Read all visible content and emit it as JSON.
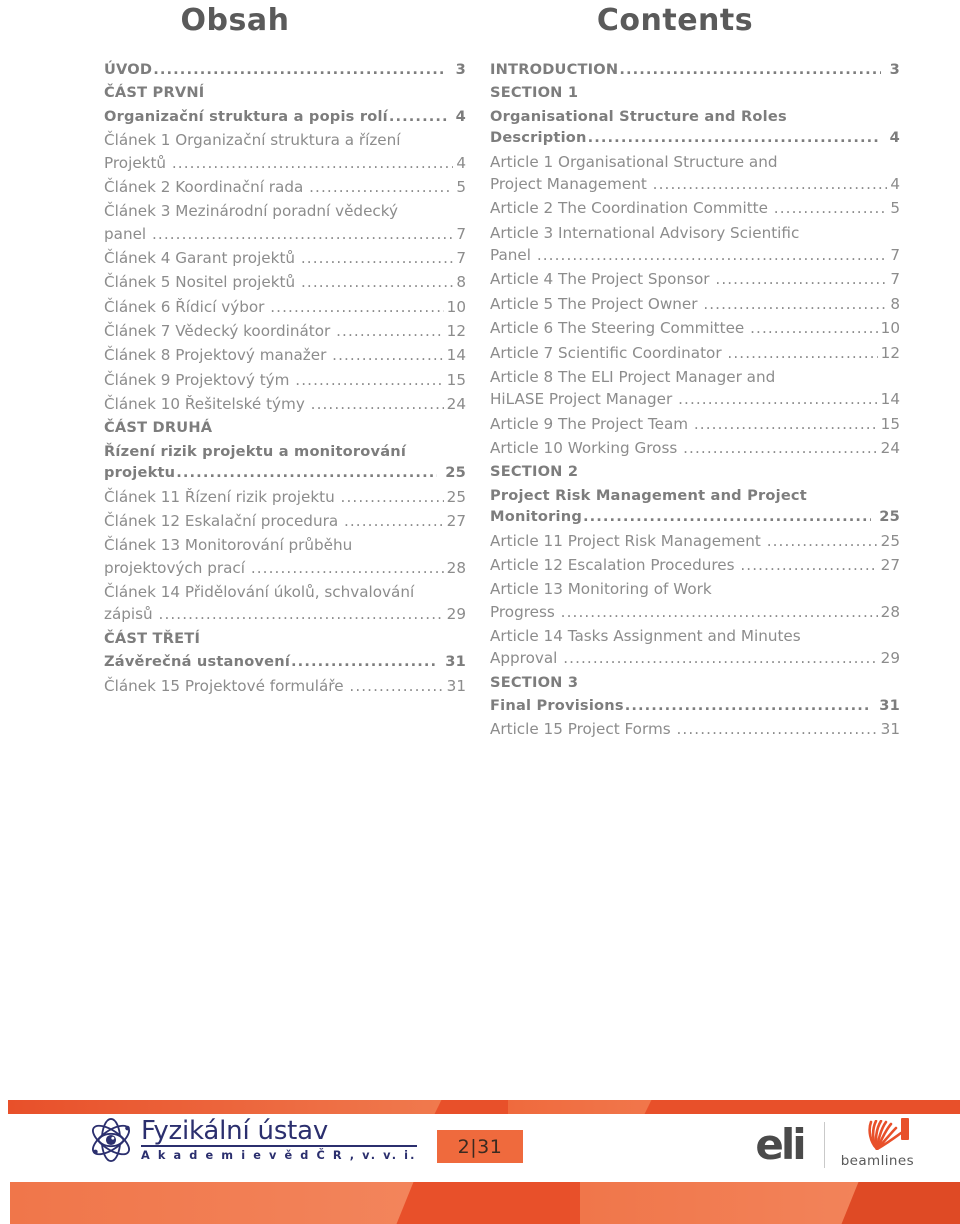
{
  "document": {
    "left_column": {
      "title": "Obsah",
      "entries": [
        {
          "text": "ÚVOD",
          "page": "3",
          "bold": true,
          "leader": true
        },
        {
          "text": "ČÁST PRVNÍ",
          "page": "",
          "bold": true,
          "leader": false
        },
        {
          "text": "Organizační struktura a popis rolí",
          "page": "4",
          "bold": true,
          "leader": true,
          "shortdots": true
        },
        {
          "text": "Článek 1 Organizační struktura a řízení Projektů",
          "page": "4",
          "bold": false,
          "leader": true,
          "wrap": "Článek 1 Organizační struktura a řízení",
          "wrap2": "Projektů"
        },
        {
          "text": "Článek 2 Koordinační rada",
          "page": "5",
          "bold": false,
          "leader": true
        },
        {
          "text": "Článek 3 Mezinárodní poradní vědecký panel",
          "page": "7",
          "bold": false,
          "leader": true,
          "wrap": "Článek 3 Mezinárodní poradní vědecký",
          "wrap2": "panel"
        },
        {
          "text": "Článek 4 Garant projektů",
          "page": "7",
          "bold": false,
          "leader": true
        },
        {
          "text": "Článek 5 Nositel projektů",
          "page": "8",
          "bold": false,
          "leader": true
        },
        {
          "text": "Článek 6 Řídicí výbor",
          "page": "10",
          "bold": false,
          "leader": true
        },
        {
          "text": "Článek 7 Vědecký koordinátor",
          "page": "12",
          "bold": false,
          "leader": true
        },
        {
          "text": "Článek 8 Projektový manažer",
          "page": "14",
          "bold": false,
          "leader": true
        },
        {
          "text": "Článek 9 Projektový tým",
          "page": "15",
          "bold": false,
          "leader": true
        },
        {
          "text": "Článek 10 Řešitelské týmy",
          "page": "24",
          "bold": false,
          "leader": true
        },
        {
          "text": "ČÁST DRUHÁ",
          "page": "",
          "bold": true,
          "leader": false
        },
        {
          "text": "Řízení rizik projektu a monitorování projektu",
          "page": "25",
          "bold": true,
          "leader": true,
          "wrap": "Řízení rizik projektu a monitorování",
          "wrap2": "projektu"
        },
        {
          "text": "Článek 11 Řízení rizik projektu",
          "page": "25",
          "bold": false,
          "leader": true
        },
        {
          "text": "Článek 12 Eskalační procedura",
          "page": "27",
          "bold": false,
          "leader": true
        },
        {
          "text": "Článek 13 Monitorování průběhu projektových prací",
          "page": "28",
          "bold": false,
          "leader": true,
          "wrap": "Článek 13 Monitorování průběhu",
          "wrap2": "projektových prací"
        },
        {
          "text": "Článek 14 Přidělování úkolů, schvalování zápisů",
          "page": "29",
          "bold": false,
          "leader": true,
          "wrap": "Článek 14 Přidělování úkolů, schvalování",
          "wrap2": "zápisů"
        },
        {
          "text": "ČÁST TŘETÍ",
          "page": "",
          "bold": true,
          "leader": false
        },
        {
          "text": "Závěrečná ustanovení",
          "page": "31",
          "bold": true,
          "leader": true
        },
        {
          "text": "Článek 15 Projektové formuláře",
          "page": "31",
          "bold": false,
          "leader": true
        }
      ]
    },
    "right_column": {
      "title": "Contents",
      "entries": [
        {
          "text": "INTRODUCTION",
          "page": "3",
          "bold": true,
          "leader": true
        },
        {
          "text": "SECTION 1",
          "page": "",
          "bold": true,
          "leader": false
        },
        {
          "text": "Organisational Structure and Roles Description",
          "page": "4",
          "bold": true,
          "leader": true,
          "wrap": "Organisational Structure and Roles",
          "wrap2": "Description"
        },
        {
          "text": "Article 1 Organisational Structure and Project Management",
          "page": "4",
          "bold": false,
          "leader": true,
          "wrap": "Article 1 Organisational Structure and",
          "wrap2": "Project Management"
        },
        {
          "text": "Article 2 The Coordination Committe",
          "page": "5",
          "bold": false,
          "leader": true,
          "shortdots": true
        },
        {
          "text": "Article 3 International Advisory Scientific Panel",
          "page": "7",
          "bold": false,
          "leader": true,
          "wrap": "Article 3 International Advisory Scientific",
          "wrap2": "Panel"
        },
        {
          "text": "Article 4 The Project Sponsor",
          "page": "7",
          "bold": false,
          "leader": true
        },
        {
          "text": "Article 5 The Project Owner",
          "page": "8",
          "bold": false,
          "leader": true
        },
        {
          "text": "Article 6 The Steering Committee",
          "page": "10",
          "bold": false,
          "leader": true
        },
        {
          "text": "Article 7 Scientific Coordinator",
          "page": "12",
          "bold": false,
          "leader": true
        },
        {
          "text": "Article 8 The ELI Project Manager and HiLASE Project Manager",
          "page": "14",
          "bold": false,
          "leader": true,
          "wrap": "Article 8 The ELI Project Manager and",
          "wrap2": "HiLASE Project Manager"
        },
        {
          "text": "Article 9 The Project Team",
          "page": "15",
          "bold": false,
          "leader": true
        },
        {
          "text": "Article 10 Working Gross",
          "page": "24",
          "bold": false,
          "leader": true
        },
        {
          "text": "SECTION 2",
          "page": "",
          "bold": true,
          "leader": false
        },
        {
          "text": "Project Risk Management and Project Monitoring",
          "page": "25",
          "bold": true,
          "leader": true,
          "wrap": "Project Risk Management and Project",
          "wrap2": "Monitoring"
        },
        {
          "text": "Article 11 Project Risk Management",
          "page": "25",
          "bold": false,
          "leader": true
        },
        {
          "text": "Article 12 Escalation Procedures",
          "page": "27",
          "bold": false,
          "leader": true
        },
        {
          "text": "Article 13 Monitoring of Work Progress",
          "page": "28",
          "bold": false,
          "leader": true,
          "wrap": "Article 13 Monitoring of Work",
          "wrap2": "Progress"
        },
        {
          "text": "Article 14 Tasks Assignment and Minutes Approval",
          "page": "29",
          "bold": false,
          "leader": true,
          "wrap": "Article 14 Tasks Assignment and Minutes",
          "wrap2": "Approval"
        },
        {
          "text": "SECTION 3",
          "page": "",
          "bold": true,
          "leader": false
        },
        {
          "text": "Final Provisions",
          "page": "31",
          "bold": true,
          "leader": true
        },
        {
          "text": "Article 15 Project Forms",
          "page": "31",
          "bold": false,
          "leader": true
        }
      ]
    },
    "footer": {
      "institute_logo": {
        "icon": "atom-eye-icon",
        "name": "Fyzikální ústav",
        "subtitle": "A k a d e m i e  v ě d  Č R , v. v. i."
      },
      "page_number": "2|31",
      "eli_logo": {
        "mark": "eli",
        "icon": "beam-fan-icon",
        "label": "beamlines"
      },
      "accent_color": "#e8502a",
      "badge_color": "#ef6a3d"
    }
  }
}
